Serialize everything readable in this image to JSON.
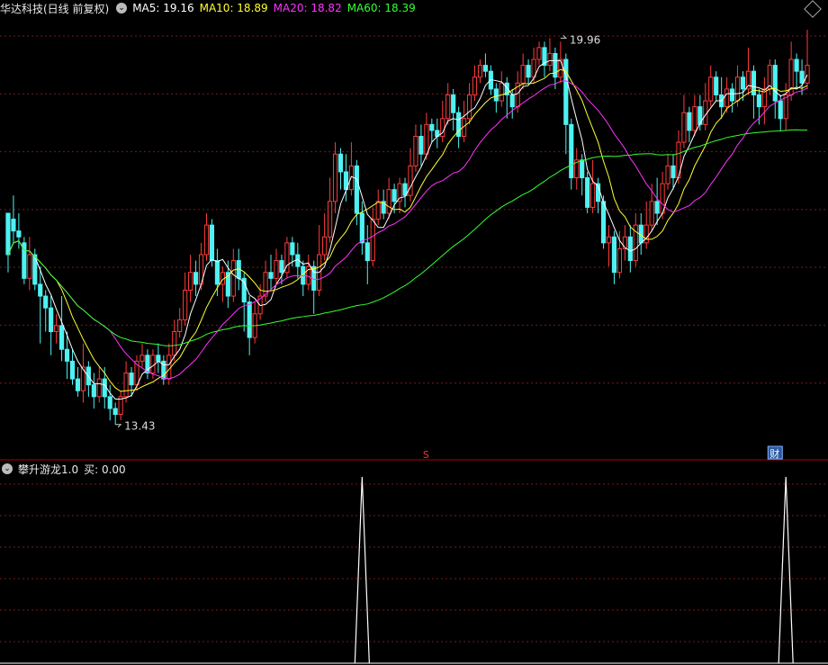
{
  "main_header": {
    "stock_title": "华达科技(日线 前复权)",
    "ma5_label": "MA5: 19.16",
    "ma10_label": "MA10: 18.89",
    "ma20_label": "MA20: 18.82",
    "ma60_label": "MA60: 18.39"
  },
  "sub_header": {
    "indicator_label": "攀升游龙1.0",
    "buy_label": "买: 0.00"
  },
  "colors": {
    "up": "#ff3b3b",
    "down": "#4ef2f2",
    "ma5": "#ffffff",
    "ma10": "#ffff33",
    "ma20": "#ff33ff",
    "ma60": "#33ff33",
    "grid": "#7a1a1a",
    "divider": "#b00000"
  },
  "chart_data": [
    {
      "type": "candlestick",
      "title": "华达科技(日线 前复权)",
      "ylim": [
        13.0,
        20.3
      ],
      "grid": "horizontal dotted",
      "high_annotation": {
        "value": "19.96",
        "index": 103
      },
      "low_annotation": {
        "value": "13.43",
        "index": 20
      },
      "markers": [
        {
          "label": "S",
          "index": 78
        },
        {
          "label": "财",
          "index": 143
        }
      ],
      "ohlc": [
        [
          17.0,
          16.3,
          16.9,
          16.0
        ],
        [
          16.9,
          16.7,
          17.3,
          16.5
        ],
        [
          16.7,
          16.6,
          17.0,
          16.4
        ],
        [
          16.5,
          15.9,
          16.6,
          15.8
        ],
        [
          15.9,
          16.3,
          16.6,
          15.7
        ],
        [
          16.3,
          15.8,
          16.4,
          15.7
        ],
        [
          15.8,
          15.6,
          16.1,
          14.8
        ],
        [
          15.6,
          15.4,
          15.7,
          15.0
        ],
        [
          15.4,
          15.0,
          15.6,
          14.6
        ],
        [
          15.0,
          15.1,
          15.3,
          14.8
        ],
        [
          15.1,
          14.7,
          15.6,
          14.5
        ],
        [
          14.7,
          14.5,
          15.0,
          14.2
        ],
        [
          14.5,
          14.2,
          14.7,
          14.1
        ],
        [
          14.2,
          14.0,
          14.4,
          13.9
        ],
        [
          14.0,
          14.4,
          14.8,
          13.8
        ],
        [
          14.4,
          14.1,
          14.5,
          13.9
        ],
        [
          14.1,
          13.9,
          14.3,
          13.7
        ],
        [
          13.9,
          14.2,
          14.4,
          13.8
        ],
        [
          14.2,
          13.9,
          14.4,
          13.7
        ],
        [
          13.9,
          13.7,
          14.1,
          13.5
        ],
        [
          13.7,
          13.6,
          13.8,
          13.43
        ],
        [
          13.6,
          13.9,
          14.0,
          13.5
        ],
        [
          13.9,
          14.3,
          14.5,
          13.8
        ],
        [
          14.3,
          14.1,
          14.4,
          13.9
        ],
        [
          14.1,
          14.5,
          14.6,
          14.0
        ],
        [
          14.5,
          14.6,
          14.8,
          14.4
        ],
        [
          14.6,
          14.3,
          14.7,
          14.2
        ],
        [
          14.3,
          14.6,
          14.7,
          14.2
        ],
        [
          14.6,
          14.5,
          14.8,
          14.3
        ],
        [
          14.5,
          14.2,
          14.6,
          14.1
        ],
        [
          14.2,
          14.6,
          14.8,
          14.1
        ],
        [
          14.6,
          15.0,
          15.2,
          14.5
        ],
        [
          15.0,
          15.2,
          15.4,
          14.9
        ],
        [
          15.2,
          15.7,
          16.0,
          15.1
        ],
        [
          15.7,
          16.0,
          16.3,
          15.5
        ],
        [
          16.0,
          15.8,
          16.2,
          15.6
        ],
        [
          15.8,
          16.3,
          16.5,
          15.7
        ],
        [
          16.3,
          16.8,
          17.0,
          16.2
        ],
        [
          16.8,
          16.2,
          16.9,
          16.1
        ],
        [
          16.2,
          15.8,
          16.4,
          15.6
        ],
        [
          15.8,
          16.0,
          16.1,
          15.5
        ],
        [
          16.0,
          15.6,
          16.2,
          15.4
        ],
        [
          15.6,
          16.2,
          16.4,
          15.5
        ],
        [
          16.2,
          15.9,
          16.4,
          15.7
        ],
        [
          15.9,
          15.5,
          16.0,
          15.0
        ],
        [
          15.5,
          14.9,
          15.6,
          14.6
        ],
        [
          14.9,
          15.3,
          15.5,
          14.8
        ],
        [
          15.3,
          15.6,
          15.8,
          15.2
        ],
        [
          15.6,
          16.0,
          16.2,
          15.5
        ],
        [
          16.0,
          15.9,
          16.3,
          15.7
        ],
        [
          15.9,
          16.2,
          16.4,
          15.8
        ],
        [
          16.2,
          16.0,
          16.3,
          15.8
        ],
        [
          16.0,
          16.5,
          16.6,
          15.9
        ],
        [
          16.5,
          16.3,
          16.6,
          16.1
        ],
        [
          16.3,
          16.1,
          16.5,
          15.9
        ],
        [
          16.1,
          15.8,
          16.2,
          15.6
        ],
        [
          15.8,
          16.1,
          16.3,
          15.7
        ],
        [
          16.1,
          15.7,
          16.2,
          15.3
        ],
        [
          15.7,
          16.3,
          16.8,
          15.6
        ],
        [
          16.3,
          16.6,
          17.0,
          16.2
        ],
        [
          16.6,
          17.2,
          17.6,
          16.5
        ],
        [
          17.2,
          18.0,
          18.2,
          17.0
        ],
        [
          18.0,
          17.7,
          18.1,
          17.4
        ],
        [
          17.7,
          17.4,
          18.0,
          17.2
        ],
        [
          17.4,
          17.8,
          18.2,
          17.3
        ],
        [
          17.8,
          17.0,
          17.9,
          16.8
        ],
        [
          17.0,
          16.5,
          17.2,
          16.3
        ],
        [
          16.5,
          16.2,
          16.8,
          15.8
        ],
        [
          16.2,
          16.9,
          17.1,
          16.1
        ],
        [
          16.9,
          17.2,
          17.4,
          16.8
        ],
        [
          17.2,
          17.0,
          17.4,
          16.9
        ],
        [
          17.0,
          17.4,
          17.6,
          16.9
        ],
        [
          17.4,
          17.2,
          17.5,
          17.0
        ],
        [
          17.2,
          17.5,
          17.6,
          17.0
        ],
        [
          17.5,
          17.3,
          17.6,
          17.1
        ],
        [
          17.3,
          17.8,
          18.1,
          17.2
        ],
        [
          17.8,
          18.3,
          18.5,
          17.7
        ],
        [
          18.3,
          18.0,
          18.5,
          17.8
        ],
        [
          18.0,
          18.5,
          18.7,
          17.9
        ],
        [
          18.5,
          18.4,
          18.6,
          18.2
        ],
        [
          18.4,
          18.3,
          18.6,
          18.1
        ],
        [
          18.3,
          18.6,
          18.9,
          18.2
        ],
        [
          18.6,
          19.0,
          19.2,
          18.5
        ],
        [
          19.0,
          18.7,
          19.1,
          18.4
        ],
        [
          18.7,
          18.3,
          18.8,
          18.1
        ],
        [
          18.3,
          18.6,
          18.9,
          18.2
        ],
        [
          18.6,
          19.0,
          19.2,
          18.5
        ],
        [
          19.0,
          19.3,
          19.5,
          18.9
        ],
        [
          19.3,
          19.5,
          19.6,
          19.2
        ],
        [
          19.5,
          19.4,
          19.7,
          19.3
        ],
        [
          19.4,
          19.1,
          19.5,
          19.0
        ],
        [
          19.1,
          18.9,
          19.2,
          18.7
        ],
        [
          18.9,
          19.2,
          19.4,
          18.8
        ],
        [
          19.2,
          19.0,
          19.3,
          18.6
        ],
        [
          19.0,
          18.8,
          19.1,
          18.6
        ],
        [
          18.8,
          19.2,
          19.4,
          18.7
        ],
        [
          19.2,
          19.5,
          19.7,
          19.1
        ],
        [
          19.5,
          19.3,
          19.6,
          19.2
        ],
        [
          19.3,
          19.6,
          19.8,
          19.2
        ],
        [
          19.6,
          19.8,
          19.9,
          19.5
        ],
        [
          19.8,
          19.5,
          19.9,
          19.3
        ],
        [
          19.5,
          19.7,
          19.96,
          19.4
        ],
        [
          19.7,
          19.3,
          19.8,
          19.1
        ],
        [
          19.3,
          19.6,
          19.9,
          19.2
        ],
        [
          19.6,
          18.5,
          19.7,
          18.0
        ],
        [
          18.5,
          17.6,
          18.6,
          17.4
        ],
        [
          17.6,
          17.9,
          18.1,
          17.4
        ],
        [
          17.9,
          17.6,
          18.0,
          17.3
        ],
        [
          17.6,
          17.1,
          17.7,
          17.0
        ],
        [
          17.1,
          17.5,
          17.9,
          17.0
        ],
        [
          17.5,
          17.2,
          17.6,
          17.0
        ],
        [
          17.2,
          16.5,
          17.3,
          16.4
        ],
        [
          16.5,
          16.6,
          16.8,
          16.1
        ],
        [
          16.6,
          16.0,
          16.7,
          15.8
        ],
        [
          16.0,
          16.4,
          16.7,
          15.9
        ],
        [
          16.4,
          16.6,
          16.8,
          16.2
        ],
        [
          16.6,
          16.2,
          16.8,
          16.0
        ],
        [
          16.2,
          16.8,
          17.0,
          16.1
        ],
        [
          16.8,
          16.5,
          17.0,
          16.3
        ],
        [
          16.5,
          16.8,
          17.2,
          16.4
        ],
        [
          16.8,
          17.2,
          17.5,
          16.7
        ],
        [
          17.2,
          17.0,
          17.6,
          16.8
        ],
        [
          17.0,
          17.5,
          17.7,
          16.9
        ],
        [
          17.5,
          17.8,
          18.0,
          17.4
        ],
        [
          17.8,
          17.6,
          18.0,
          17.4
        ],
        [
          17.6,
          18.2,
          18.4,
          17.5
        ],
        [
          18.2,
          18.7,
          19.0,
          18.1
        ],
        [
          18.7,
          18.4,
          18.8,
          18.2
        ],
        [
          18.4,
          18.8,
          19.0,
          18.3
        ],
        [
          18.8,
          18.5,
          19.0,
          18.4
        ],
        [
          18.5,
          18.9,
          19.2,
          18.4
        ],
        [
          18.9,
          19.3,
          19.5,
          18.8
        ],
        [
          19.3,
          19.0,
          19.4,
          18.9
        ],
        [
          19.0,
          18.8,
          19.3,
          18.6
        ],
        [
          18.8,
          19.1,
          19.3,
          18.7
        ],
        [
          19.1,
          18.9,
          19.2,
          18.7
        ],
        [
          18.9,
          19.3,
          19.5,
          18.8
        ],
        [
          19.3,
          19.1,
          19.4,
          18.9
        ],
        [
          19.1,
          19.4,
          19.8,
          19.0
        ],
        [
          19.4,
          19.0,
          19.5,
          18.6
        ],
        [
          19.0,
          18.8,
          19.1,
          18.5
        ],
        [
          18.8,
          19.1,
          19.3,
          18.5
        ],
        [
          19.1,
          19.5,
          19.6,
          19.0
        ],
        [
          19.5,
          18.9,
          19.6,
          18.6
        ],
        [
          18.9,
          18.6,
          19.0,
          18.4
        ],
        [
          18.6,
          19.0,
          19.2,
          18.4
        ],
        [
          19.0,
          19.6,
          19.9,
          18.9
        ],
        [
          19.6,
          19.4,
          19.7,
          19.1
        ],
        [
          19.4,
          19.2,
          19.6,
          19.0
        ],
        [
          19.2,
          19.5,
          20.1,
          19.1
        ]
      ],
      "series": [
        {
          "name": "MA5",
          "values": [
            19.2,
            19.16
          ]
        },
        {
          "name": "MA10",
          "values": [
            18.9,
            18.89
          ]
        },
        {
          "name": "MA20",
          "values": [
            18.8,
            18.82
          ]
        },
        {
          "name": "MA60",
          "values": [
            18.4,
            18.39
          ]
        }
      ]
    },
    {
      "type": "line",
      "title": "攀升游龙1.0",
      "ylim": [
        0,
        1
      ],
      "spikes_at_index": [
        66,
        145
      ],
      "values_note": "0 except spikes of 1"
    }
  ]
}
